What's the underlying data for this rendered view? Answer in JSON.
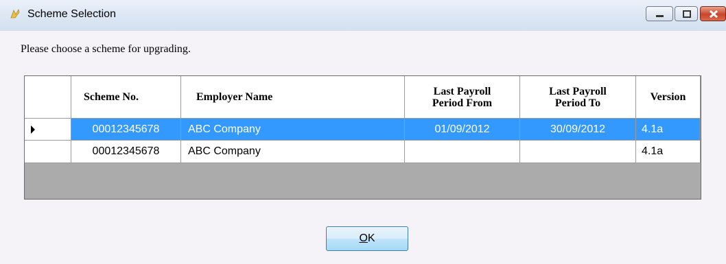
{
  "window": {
    "title": "Scheme Selection"
  },
  "prompt": "Please choose a scheme for upgrading.",
  "grid": {
    "columns": [
      "Scheme No.",
      "Employer Name",
      "Last Payroll Period From",
      "Last Payroll Period To",
      "Version"
    ],
    "rows": [
      {
        "scheme_no": "00012345678",
        "employer": "ABC Company",
        "from": "01/09/2012",
        "to": "30/09/2012",
        "version": "4.1a",
        "selected": true
      },
      {
        "scheme_no": "00012345678",
        "employer": "ABC Company",
        "from": "",
        "to": "",
        "version": "4.1a",
        "selected": false
      }
    ]
  },
  "buttons": {
    "ok": "OK"
  }
}
